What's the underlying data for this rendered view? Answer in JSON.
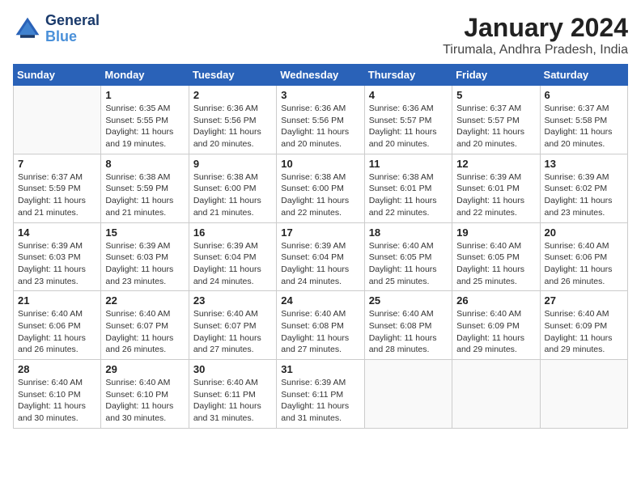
{
  "logo": {
    "line1": "General",
    "line2": "Blue"
  },
  "title": "January 2024",
  "subtitle": "Tirumala, Andhra Pradesh, India",
  "headers": [
    "Sunday",
    "Monday",
    "Tuesday",
    "Wednesday",
    "Thursday",
    "Friday",
    "Saturday"
  ],
  "weeks": [
    [
      {
        "num": "",
        "info": ""
      },
      {
        "num": "1",
        "info": "Sunrise: 6:35 AM\nSunset: 5:55 PM\nDaylight: 11 hours and 19 minutes."
      },
      {
        "num": "2",
        "info": "Sunrise: 6:36 AM\nSunset: 5:56 PM\nDaylight: 11 hours and 20 minutes."
      },
      {
        "num": "3",
        "info": "Sunrise: 6:36 AM\nSunset: 5:56 PM\nDaylight: 11 hours and 20 minutes."
      },
      {
        "num": "4",
        "info": "Sunrise: 6:36 AM\nSunset: 5:57 PM\nDaylight: 11 hours and 20 minutes."
      },
      {
        "num": "5",
        "info": "Sunrise: 6:37 AM\nSunset: 5:57 PM\nDaylight: 11 hours and 20 minutes."
      },
      {
        "num": "6",
        "info": "Sunrise: 6:37 AM\nSunset: 5:58 PM\nDaylight: 11 hours and 20 minutes."
      }
    ],
    [
      {
        "num": "7",
        "info": "Sunrise: 6:37 AM\nSunset: 5:59 PM\nDaylight: 11 hours and 21 minutes."
      },
      {
        "num": "8",
        "info": "Sunrise: 6:38 AM\nSunset: 5:59 PM\nDaylight: 11 hours and 21 minutes."
      },
      {
        "num": "9",
        "info": "Sunrise: 6:38 AM\nSunset: 6:00 PM\nDaylight: 11 hours and 21 minutes."
      },
      {
        "num": "10",
        "info": "Sunrise: 6:38 AM\nSunset: 6:00 PM\nDaylight: 11 hours and 22 minutes."
      },
      {
        "num": "11",
        "info": "Sunrise: 6:38 AM\nSunset: 6:01 PM\nDaylight: 11 hours and 22 minutes."
      },
      {
        "num": "12",
        "info": "Sunrise: 6:39 AM\nSunset: 6:01 PM\nDaylight: 11 hours and 22 minutes."
      },
      {
        "num": "13",
        "info": "Sunrise: 6:39 AM\nSunset: 6:02 PM\nDaylight: 11 hours and 23 minutes."
      }
    ],
    [
      {
        "num": "14",
        "info": "Sunrise: 6:39 AM\nSunset: 6:03 PM\nDaylight: 11 hours and 23 minutes."
      },
      {
        "num": "15",
        "info": "Sunrise: 6:39 AM\nSunset: 6:03 PM\nDaylight: 11 hours and 23 minutes."
      },
      {
        "num": "16",
        "info": "Sunrise: 6:39 AM\nSunset: 6:04 PM\nDaylight: 11 hours and 24 minutes."
      },
      {
        "num": "17",
        "info": "Sunrise: 6:39 AM\nSunset: 6:04 PM\nDaylight: 11 hours and 24 minutes."
      },
      {
        "num": "18",
        "info": "Sunrise: 6:40 AM\nSunset: 6:05 PM\nDaylight: 11 hours and 25 minutes."
      },
      {
        "num": "19",
        "info": "Sunrise: 6:40 AM\nSunset: 6:05 PM\nDaylight: 11 hours and 25 minutes."
      },
      {
        "num": "20",
        "info": "Sunrise: 6:40 AM\nSunset: 6:06 PM\nDaylight: 11 hours and 26 minutes."
      }
    ],
    [
      {
        "num": "21",
        "info": "Sunrise: 6:40 AM\nSunset: 6:06 PM\nDaylight: 11 hours and 26 minutes."
      },
      {
        "num": "22",
        "info": "Sunrise: 6:40 AM\nSunset: 6:07 PM\nDaylight: 11 hours and 26 minutes."
      },
      {
        "num": "23",
        "info": "Sunrise: 6:40 AM\nSunset: 6:07 PM\nDaylight: 11 hours and 27 minutes."
      },
      {
        "num": "24",
        "info": "Sunrise: 6:40 AM\nSunset: 6:08 PM\nDaylight: 11 hours and 27 minutes."
      },
      {
        "num": "25",
        "info": "Sunrise: 6:40 AM\nSunset: 6:08 PM\nDaylight: 11 hours and 28 minutes."
      },
      {
        "num": "26",
        "info": "Sunrise: 6:40 AM\nSunset: 6:09 PM\nDaylight: 11 hours and 29 minutes."
      },
      {
        "num": "27",
        "info": "Sunrise: 6:40 AM\nSunset: 6:09 PM\nDaylight: 11 hours and 29 minutes."
      }
    ],
    [
      {
        "num": "28",
        "info": "Sunrise: 6:40 AM\nSunset: 6:10 PM\nDaylight: 11 hours and 30 minutes."
      },
      {
        "num": "29",
        "info": "Sunrise: 6:40 AM\nSunset: 6:10 PM\nDaylight: 11 hours and 30 minutes."
      },
      {
        "num": "30",
        "info": "Sunrise: 6:40 AM\nSunset: 6:11 PM\nDaylight: 11 hours and 31 minutes."
      },
      {
        "num": "31",
        "info": "Sunrise: 6:39 AM\nSunset: 6:11 PM\nDaylight: 11 hours and 31 minutes."
      },
      {
        "num": "",
        "info": ""
      },
      {
        "num": "",
        "info": ""
      },
      {
        "num": "",
        "info": ""
      }
    ]
  ]
}
